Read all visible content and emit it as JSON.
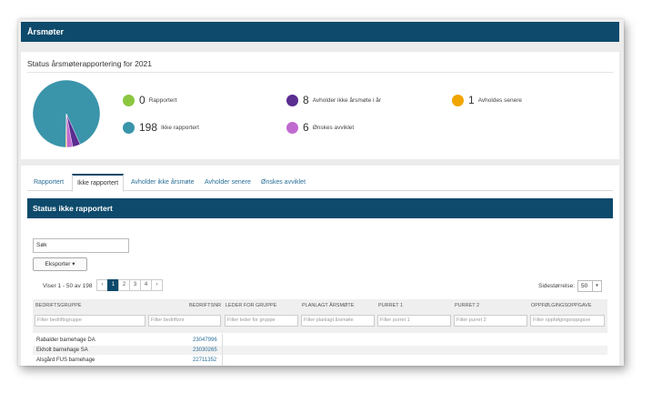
{
  "window": {
    "title": "Årsmøter"
  },
  "summary": {
    "title": "Status årsmøterapportering for 2021",
    "legend": [
      {
        "count": "0",
        "label": "Rapportert",
        "color": "#8cc63f"
      },
      {
        "count": "8",
        "label": "Avholder ikke årsmøte i år",
        "color": "#5a2d91"
      },
      {
        "count": "1",
        "label": "Avholdes senere",
        "color": "#f0a500"
      },
      {
        "count": "198",
        "label": "Ikke rapportert",
        "color": "#3a94aa"
      },
      {
        "count": "6",
        "label": "Ønskes avviklet",
        "color": "#c06ad0"
      }
    ],
    "pie": [
      {
        "label": "Ikke rapportert",
        "value": 198,
        "color": "#3a94aa"
      },
      {
        "label": "Avholder ikke årsmøte i år",
        "value": 8,
        "color": "#5a2d91"
      },
      {
        "label": "Ønskes avviklet",
        "value": 6,
        "color": "#c06ad0"
      },
      {
        "label": "Avholdes senere",
        "value": 1,
        "color": "#f0a500"
      }
    ]
  },
  "tabs": [
    "Rapportert",
    "Ikke rapportert",
    "Avholder ikke årsmøte",
    "Avholder senere",
    "Ønskes avviklet"
  ],
  "section": {
    "title": "Status ikke rapportert",
    "search_value": "Søk",
    "export_label": "Eksporter",
    "pager_text": "Viser 1 - 50 av 198",
    "pages": [
      "1",
      "2",
      "3",
      "4"
    ],
    "prev": "‹",
    "next": "›",
    "page_size_label": "Sidestørrelse:",
    "page_size": "50"
  },
  "table": {
    "columns": [
      "BEDRIFTSGRUPPE",
      "BEDRIFTSNR",
      "LEDER FOR GRUPPE",
      "PLANLAGT ÅRSMØTE",
      "PURRET 1",
      "PURRET 2",
      "OPPFØLGINGSOPPGAVE"
    ],
    "filters": [
      "Filter bedriftsgruppe",
      "Filter bedriftsnr",
      "Filter leder for gruppe",
      "Filter planlagt årsmøte",
      "Filter purret 1",
      "Filter purret 2",
      "Filter oppfølgingsoppgave"
    ],
    "rows": [
      {
        "name": "Rabalder barnehage DA",
        "nr": "23047996"
      },
      {
        "name": "Ekholt barnehage SA",
        "nr": "23030265"
      },
      {
        "name": "Alsgård FUS barnehage",
        "nr": "22711352"
      }
    ]
  }
}
